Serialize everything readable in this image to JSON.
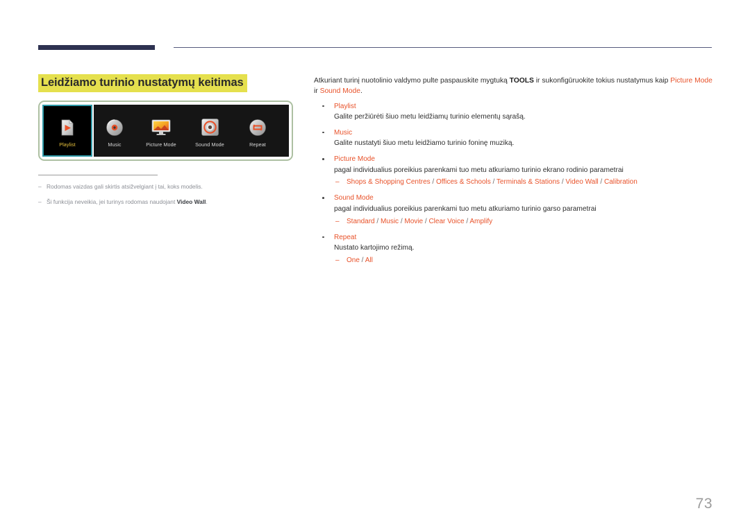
{
  "page": {
    "title": "Leidžiamo turinio nustatymų keitimas",
    "number": "73"
  },
  "figure": {
    "items": [
      {
        "label": "Playlist",
        "icon": "playlist-file-icon",
        "selected": true
      },
      {
        "label": "Music",
        "icon": "music-disc-icon",
        "selected": false
      },
      {
        "label": "Picture Mode",
        "icon": "picture-mode-icon",
        "selected": false
      },
      {
        "label": "Sound Mode",
        "icon": "sound-mode-icon",
        "selected": false
      },
      {
        "label": "Repeat",
        "icon": "repeat-loop-icon",
        "selected": false
      }
    ]
  },
  "footnotes": [
    {
      "dash": "–",
      "text_before": "Rodomas vaizdas gali skirtis atsižvelgiant į tai, koks modelis.",
      "bold": "",
      "text_after": ""
    },
    {
      "dash": "–",
      "text_before": "Ši funkcija neveikia, jei turinys rodomas naudojant ",
      "bold": "Video Wall",
      "text_after": "."
    }
  ],
  "intro": {
    "part1": "Atkuriant turinį nuotolinio valdymo pulte paspauskite mygtuką ",
    "tools": "TOOLS",
    "part2": " ir sukonfigūruokite tokius nustatymus kaip ",
    "accent1": "Picture Mode",
    "part3": " ir ",
    "accent2": "Sound Mode",
    "part4": "."
  },
  "bullets": [
    {
      "title": "Playlist",
      "desc": "Galite peržiūrėti šiuo metu leidžiamų turinio elementų sąrašą.",
      "options": []
    },
    {
      "title": "Music",
      "desc": "Galite nustatyti šiuo metu leidžiamo turinio foninę muziką.",
      "options": []
    },
    {
      "title": "Picture Mode",
      "desc": "pagal individualius poreikius parenkami tuo metu atkuriamo turinio ekrano rodinio parametrai",
      "options": [
        "Shops & Shopping Centres",
        "Offices & Schools",
        "Terminals & Stations",
        "Video Wall",
        "Calibration"
      ]
    },
    {
      "title": "Sound Mode",
      "desc": "pagal individualius poreikius parenkami tuo metu atkuriamo turinio garso parametrai",
      "options": [
        "Standard",
        "Music",
        "Movie",
        "Clear Voice",
        "Amplify"
      ]
    },
    {
      "title": "Repeat",
      "desc": "Nustato kartojimo režimą.",
      "options": [
        "One",
        "All"
      ]
    }
  ],
  "colors": {
    "accent": "#e8522a",
    "highlight": "#e5e04e",
    "rule_dark": "#2e3251",
    "figure_border": "#adc0a2",
    "selection_border": "#2f9aa8",
    "selected_label": "#e8c23c",
    "page_number": "#9b9b9b"
  }
}
